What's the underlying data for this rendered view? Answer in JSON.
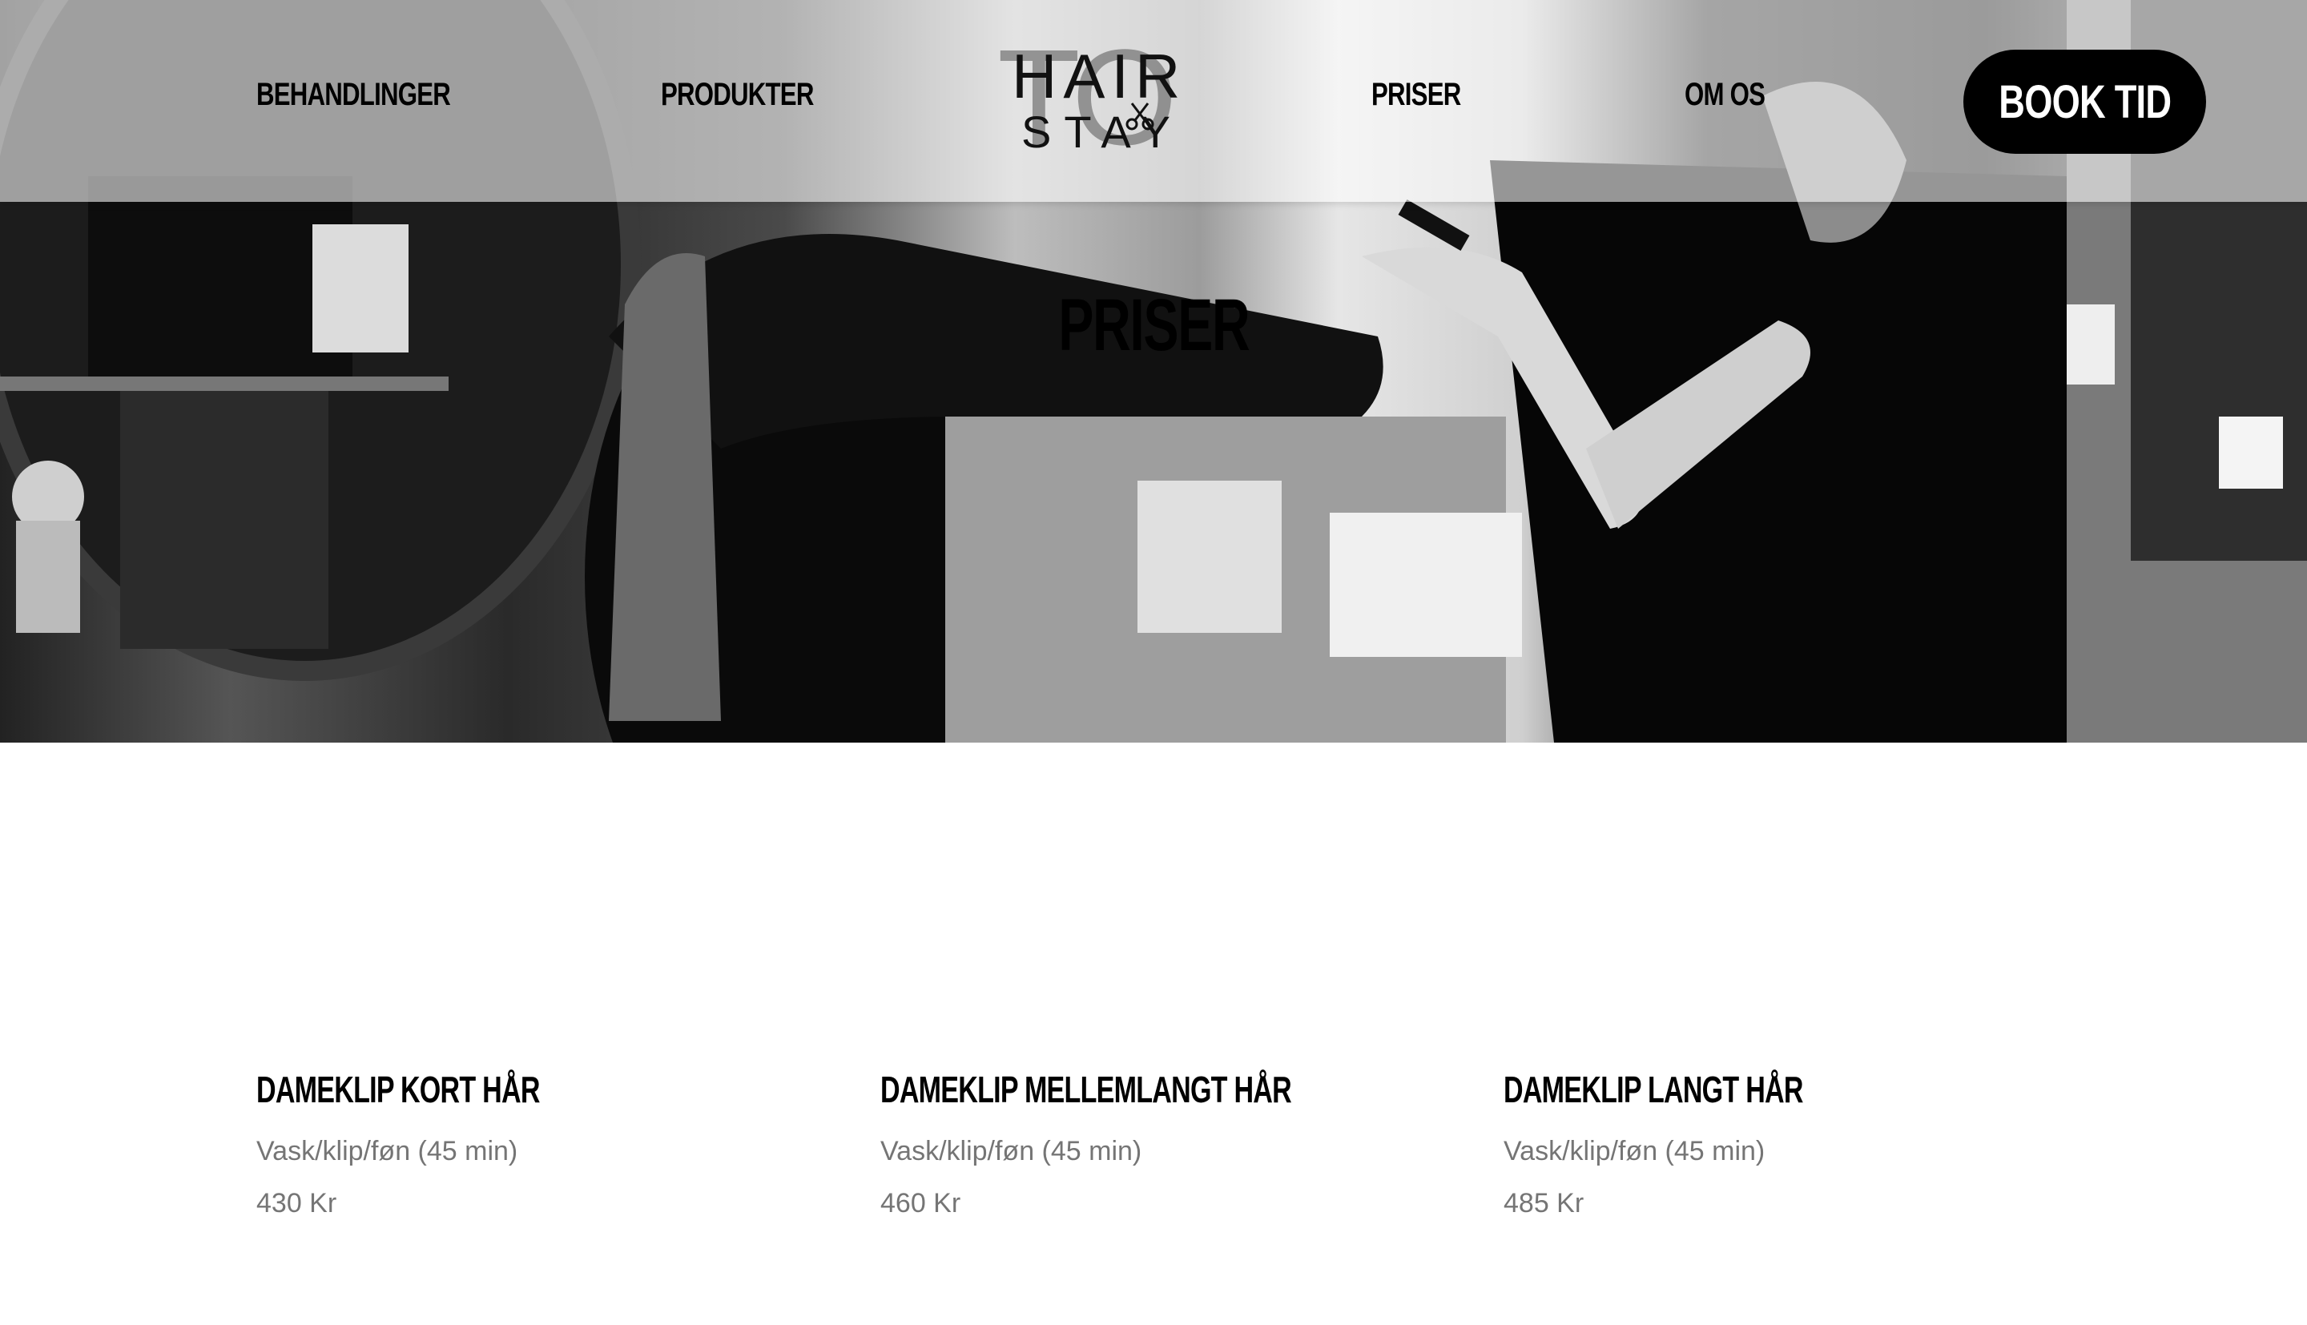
{
  "nav": {
    "items": [
      {
        "label": "BEHANDLINGER"
      },
      {
        "label": "PRODUKTER"
      },
      {
        "label": "PRISER"
      },
      {
        "label": "OM OS"
      }
    ],
    "book_label": "BOOK TID"
  },
  "logo": {
    "line1": "HAIR",
    "line2": "STAY",
    "watermark": "TO",
    "icon": "scissors-icon"
  },
  "hero": {
    "title": "PRISER"
  },
  "prices": [
    {
      "title": "DAMEKLIP KORT HÅR",
      "description": "Vask/klip/føn (45 min)",
      "price": "430 Kr"
    },
    {
      "title": "DAMEKLIP MELLEMLANGT HÅR",
      "description": "Vask/klip/føn (45 min)",
      "price": "460 Kr"
    },
    {
      "title": "DAMEKLIP LANGT HÅR",
      "description": "Vask/klip/føn (45 min)",
      "price": "485 Kr"
    }
  ],
  "colors": {
    "button_bg": "#000000",
    "button_text": "#ffffff",
    "muted_text": "#757575"
  }
}
